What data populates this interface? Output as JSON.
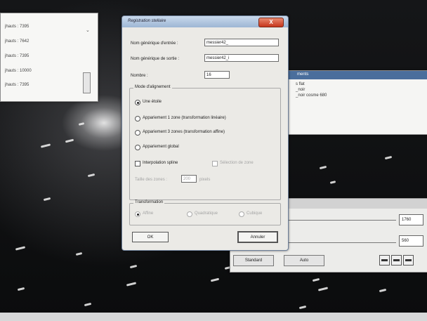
{
  "left_window": {
    "rows": [
      "jhauts : 7395",
      "jhauts : 7642",
      "jhauts : 7395",
      "jhauts : 10000",
      "jhauts : 7395"
    ]
  },
  "right_window": {
    "title": "ments",
    "rows": [
      "s flat",
      "_noir",
      "_noir cosme 680"
    ]
  },
  "bottom_panel": {
    "value_top": "1760",
    "value_bottom": "560",
    "auto_label": "Auto",
    "left_button_label": "Standard"
  },
  "dialog": {
    "title": "Registration stellaire",
    "close_label": "X",
    "input_name_label": "Nom générique d'entrée :",
    "input_name_value": "messier42_",
    "output_name_label": "Nom générique de sortie :",
    "output_name_value": "messier42_i",
    "count_label": "Nombre :",
    "count_value": "16",
    "alignment_group": {
      "legend": "Mode d'alignement",
      "options": [
        "Une étoile",
        "Appariement 1 zone (transformation linéaire)",
        "Appariement 3 zones (transformation affine)",
        "Appariement global"
      ],
      "selected": 0
    },
    "interpolation_label": "Interpolation spline",
    "zone_select_label": "Sélection de zone",
    "zone_size_label": "Taille des zones :",
    "zone_size_value": "200",
    "zone_size_unit": "pixels",
    "transform_group": {
      "legend": "Transformation",
      "options": [
        "Affine",
        "Quadratique",
        "Cubique"
      ]
    },
    "ok_label": "OK",
    "cancel_label": "Annuler"
  }
}
